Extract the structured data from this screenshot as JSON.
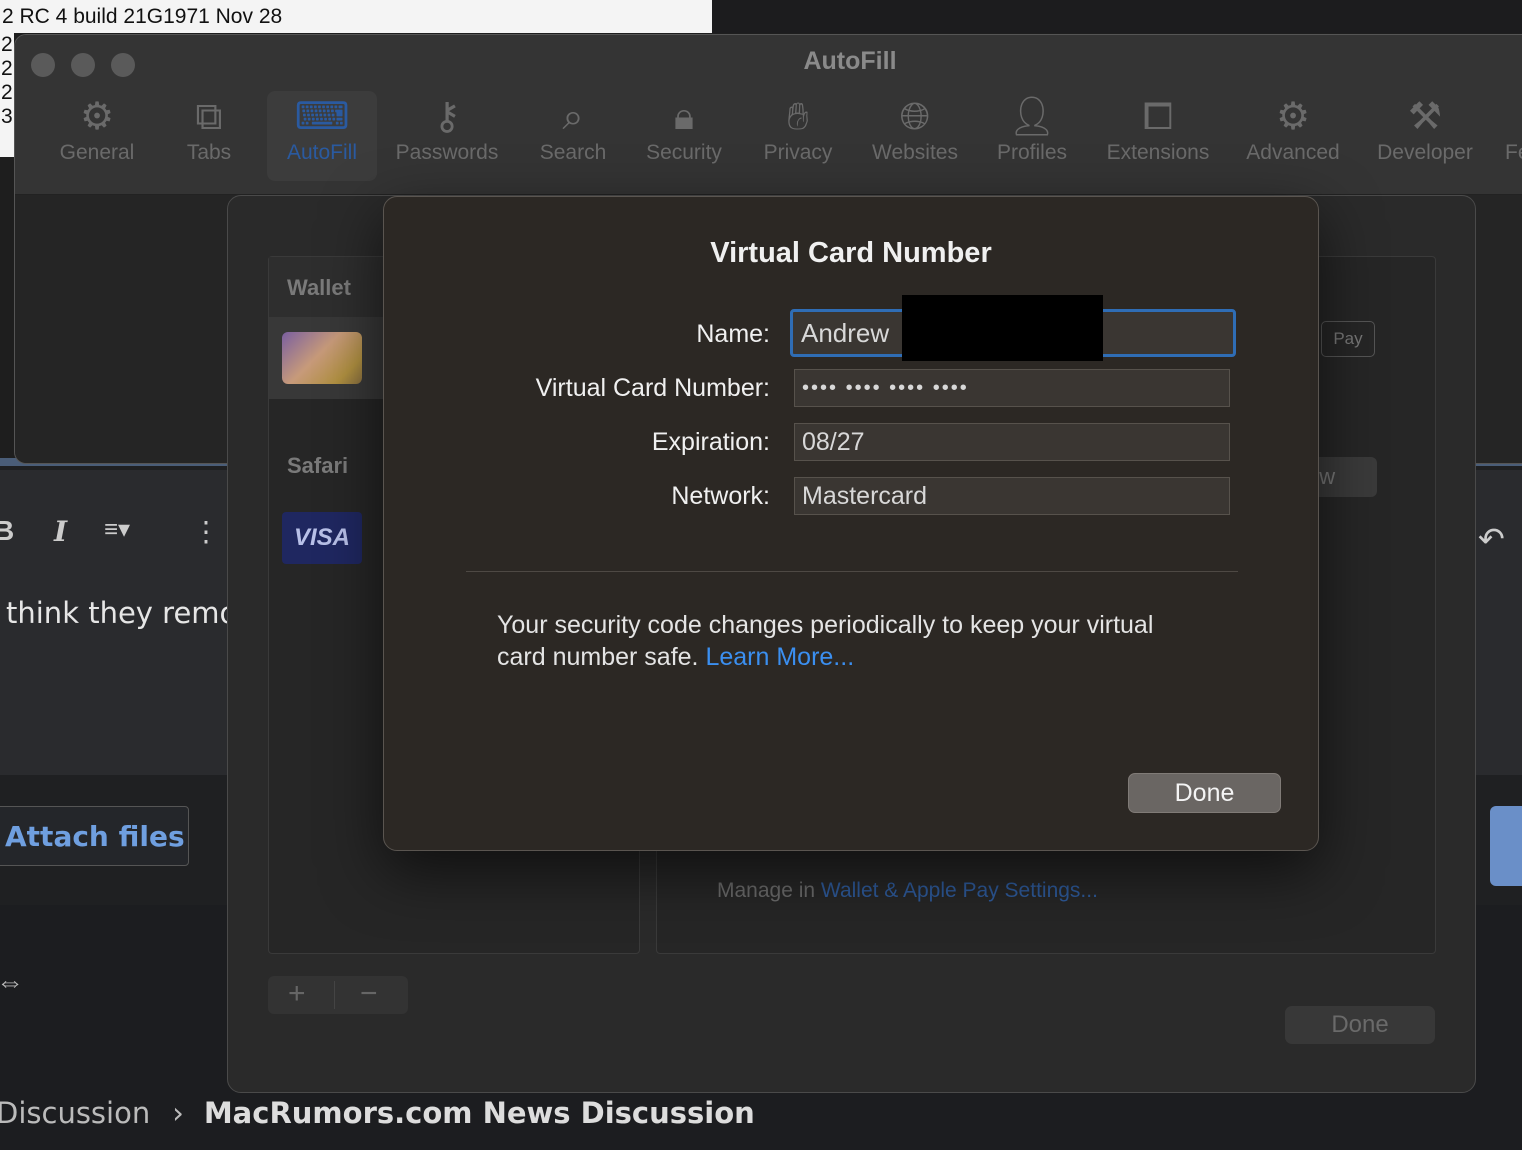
{
  "background": {
    "top_strip_text": "2 RC 4 build 21G1971 Nov 28",
    "left_strip_lines": [
      "2",
      "2",
      "2",
      "3"
    ],
    "editor_text": "think they remo",
    "attach_label": "Attach files",
    "breadcrumb": {
      "parent": "Discussion",
      "separator": "›",
      "current": "MacRumors.com News Discussion"
    },
    "icons": {
      "bold": "B",
      "italic": "I",
      "align": "≡▾",
      "more": "⋮",
      "link": "⇔",
      "undo": "↶"
    }
  },
  "settings_window": {
    "title": "AutoFill",
    "toolbar": [
      {
        "label": "General",
        "icon": "⚙",
        "selected": false
      },
      {
        "label": "Tabs",
        "icon": "⧉",
        "selected": false
      },
      {
        "label": "AutoFill",
        "icon": "⌨",
        "selected": true
      },
      {
        "label": "Passwords",
        "icon": "⚷",
        "selected": false
      },
      {
        "label": "Search",
        "icon": "⌕",
        "selected": false
      },
      {
        "label": "Security",
        "icon": "🔒︎",
        "selected": false
      },
      {
        "label": "Privacy",
        "icon": "✋︎",
        "selected": false
      },
      {
        "label": "Websites",
        "icon": "🌐︎",
        "selected": false
      },
      {
        "label": "Profiles",
        "icon": "👤︎",
        "selected": false
      },
      {
        "label": "Extensions",
        "icon": "⧠",
        "selected": false
      },
      {
        "label": "Advanced",
        "icon": "⚙",
        "selected": false
      },
      {
        "label": "Developer",
        "icon": "⚒",
        "selected": false
      },
      {
        "label": "Fe",
        "icon": "",
        "selected": false
      }
    ]
  },
  "autofill_sheet": {
    "wallet_header": "Wallet",
    "safari_header": "Safari",
    "visa_label": "VISA",
    "apple_pay_badge": "Pay",
    "view_button_partial": "ew",
    "manage_prefix": "Manage in ",
    "manage_link": "Wallet & Apple Pay Settings...",
    "plus": "+",
    "minus": "−",
    "done_label": "Done"
  },
  "dialog": {
    "title": "Virtual Card Number",
    "fields": {
      "name_label": "Name:",
      "name_value": "Andrew",
      "vcn_label": "Virtual Card Number:",
      "vcn_value": "•••• •••• •••• ••••",
      "exp_label": "Expiration:",
      "exp_value": "08/27",
      "network_label": "Network:",
      "network_value": "Mastercard"
    },
    "note": "Your security code changes periodically to keep your virtual card number safe.",
    "learn_more": "Learn More...",
    "done_label": "Done"
  },
  "colors": {
    "accent": "#3b8ff0",
    "focus_ring": "#2f6db5",
    "dialog_bg": "#2c2824"
  }
}
